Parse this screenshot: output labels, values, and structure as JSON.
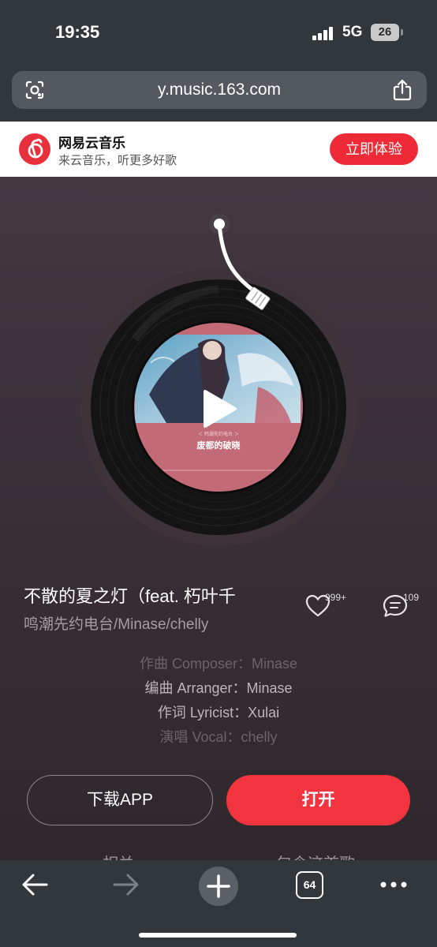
{
  "status_bar": {
    "time": "19:35",
    "network": "5G",
    "battery": "26"
  },
  "browser": {
    "url": "y.music.163.com",
    "tabs_count": "64"
  },
  "app_banner": {
    "name": "网易云音乐",
    "slogan": "来云音乐，听更多好歌",
    "cta_label": "立即体验"
  },
  "player": {
    "album_tag": "＜ 鸣潮先约电台 ＞",
    "album_title": "废都的破晓",
    "song_title": "不散的夏之灯（feat. 朽叶千",
    "artist": "鸣潮先约电台/Minase/chelly",
    "like_count": "999+",
    "comment_count": "109",
    "is_playing": false
  },
  "credits": [
    {
      "text": "作曲 Composer：Minase",
      "color": "#6b6368"
    },
    {
      "text": "编曲 Arranger：Minase",
      "color": "#bdb5ba"
    },
    {
      "text": "作词 Lyricist：Xulai",
      "color": "#bdb5ba"
    },
    {
      "text": "演唱 Vocal：chelly",
      "color": "#6b6368"
    }
  ],
  "actions": {
    "download_label": "下载APP",
    "open_label": "打开"
  },
  "peek": {
    "left": "相关",
    "right": "包含这首歌"
  },
  "colors": {
    "brand_red": "#ee2a36",
    "browser_chrome": "#32373c",
    "background": "#3a3039"
  }
}
